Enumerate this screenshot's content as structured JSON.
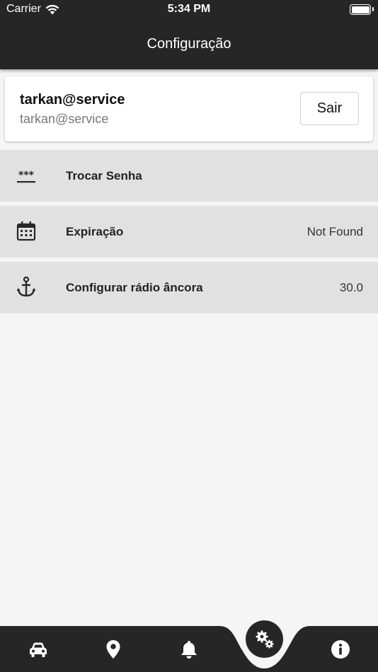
{
  "status_bar": {
    "carrier": "Carrier",
    "time": "5:34 PM"
  },
  "app_bar": {
    "title": "Configuração"
  },
  "account": {
    "name": "tarkan@service",
    "email": "tarkan@service",
    "logout_label": "Sair"
  },
  "settings": {
    "items": [
      {
        "icon": "password-icon",
        "label": "Trocar Senha",
        "value": ""
      },
      {
        "icon": "calendar-icon",
        "label": "Expiração",
        "value": "Not Found"
      },
      {
        "icon": "anchor-icon",
        "label": "Configurar rádio âncora",
        "value": "30.0"
      }
    ]
  },
  "bottom_nav": {
    "items": [
      {
        "icon": "car-icon"
      },
      {
        "icon": "map-pin-icon"
      },
      {
        "icon": "bell-icon"
      },
      {
        "icon": "settings-gears-icon",
        "active": true
      },
      {
        "icon": "info-icon"
      }
    ]
  },
  "colors": {
    "bar": "#262626",
    "row": "#e1e1e1",
    "background": "#f5f5f5"
  }
}
